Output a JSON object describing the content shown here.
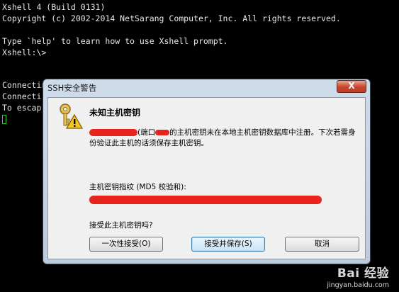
{
  "terminal": {
    "lines": [
      "Xshell 4 (Build 0131)",
      "Copyright (c) 2002-2014 NetSarang Computer, Inc. All rights reserved.",
      "",
      "Type `help' to learn how to use Xshell prompt.",
      "Xshell:\\>",
      "",
      "Connecting to",
      "Connecti",
      "To escap"
    ],
    "ellipsis": "..",
    "cursor_color": "#2dd22d"
  },
  "dialog": {
    "title": "SSH安全警告",
    "close_label": "X",
    "heading": "未知主机密钥",
    "message_port_prefix": "(端口",
    "message_text": "的主机密钥未在本地主机密钥数据库中注册。下次若需身份验证此主机的话须保存主机密钥。",
    "fingerprint_label": "主机密钥指纹 (MD5 校验和):",
    "question": "接受此主机密钥吗?",
    "buttons": {
      "accept_once": "一次性接受(O)",
      "accept_save": "接受并保存(S)",
      "cancel": "取消"
    }
  },
  "watermark": {
    "brand": "Bai 经验",
    "url": "jingyan.baidu.com"
  },
  "colors": {
    "redaction": "#e8231c",
    "terminal_bg": "#000000",
    "terminal_fg": "#e8e8e8"
  }
}
